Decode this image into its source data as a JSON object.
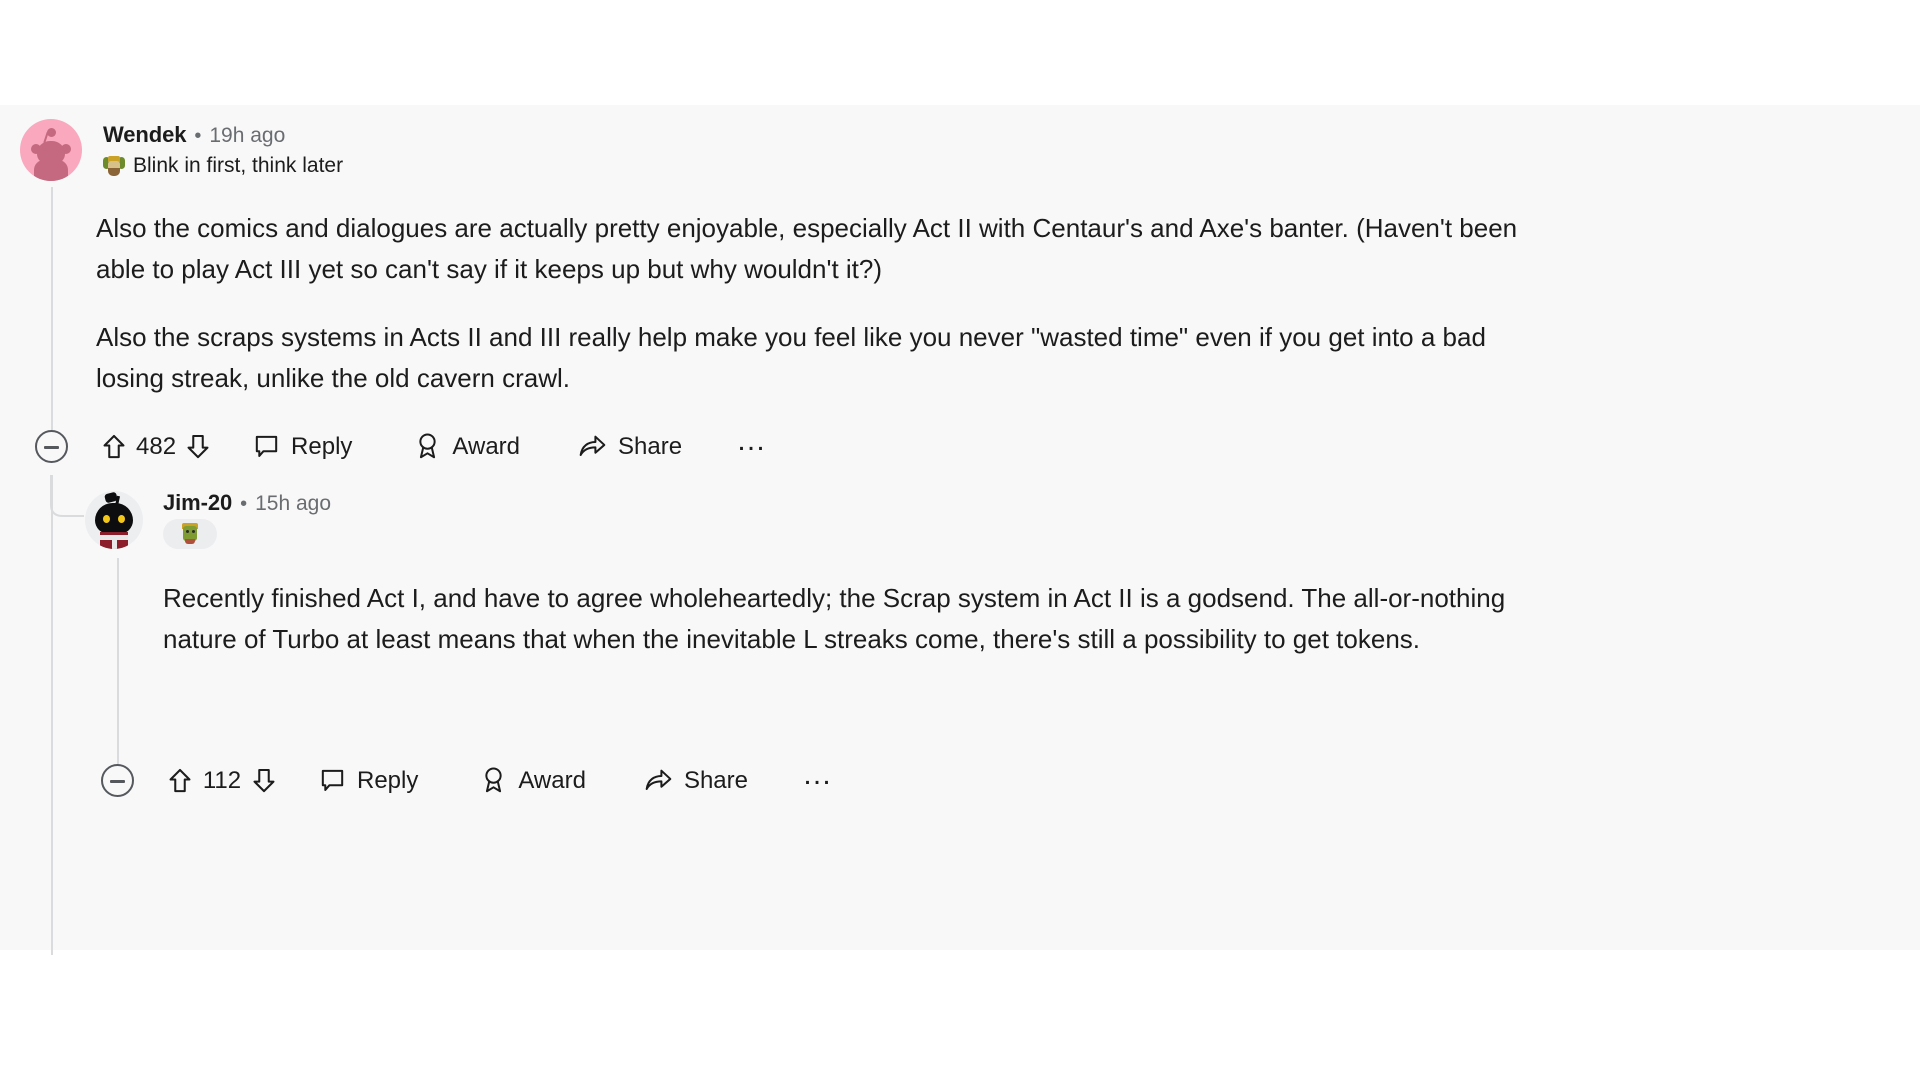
{
  "page": {
    "surface_bg": "#f8f8f9",
    "page_bg": "#ffffff",
    "text_color": "#1c1c1c",
    "muted_color": "#6a6d70",
    "thread_line_color": "#d9dbdd"
  },
  "comments": [
    {
      "id": "top-level",
      "username": "Wendek",
      "separator": "•",
      "timestamp": "19h ago",
      "avatar": "snoo-pink-avatar",
      "flair_icon": "user-flair-emoji",
      "flair_text": "Blink in first, think later",
      "paragraphs": [
        "Also the comics and dialogues are actually pretty enjoyable, especially Act II with Centaur's and Axe's banter. (Haven't been able to play Act III yet so can't say if it keeps up but why wouldn't it?)",
        "Also the scraps systems in Acts II and III really help make you feel like you never \"wasted time\" even if you get into a bad losing streak, unlike the old cavern crawl."
      ],
      "actions": {
        "collapse_label": "Collapse comment thread",
        "upvote_label": "Upvote",
        "score": "482",
        "downvote_label": "Downvote",
        "reply_label": "Reply",
        "award_label": "Award",
        "share_label": "Share",
        "more_label": "…"
      }
    },
    {
      "id": "nested-reply",
      "username": "Jim-20",
      "separator": "•",
      "timestamp": "15h ago",
      "avatar": "snoo-dark-avatar",
      "flair_badge_icon": "flair-badge-emoji",
      "flair_text": "",
      "paragraphs": [
        "Recently finished Act I, and have to agree wholeheartedly; the Scrap system in Act II is a godsend. The all-or-nothing nature of Turbo at least means that when the inevitable L streaks come, there's still a possibility to get tokens."
      ],
      "actions": {
        "collapse_label": "Collapse comment thread",
        "upvote_label": "Upvote",
        "score": "112",
        "downvote_label": "Downvote",
        "reply_label": "Reply",
        "award_label": "Award",
        "share_label": "Share",
        "more_label": "…"
      }
    }
  ]
}
